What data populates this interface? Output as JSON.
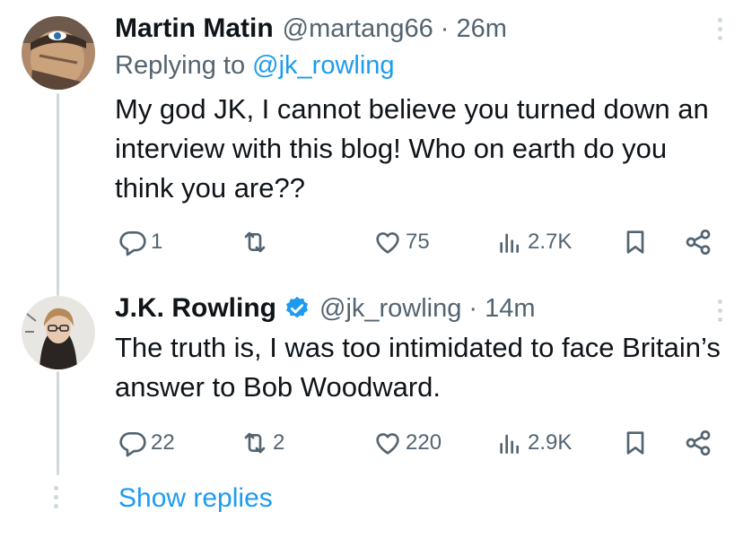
{
  "tweets": [
    {
      "name": "Martin Matin",
      "handle": "@martang66",
      "separator": "·",
      "time": "26m",
      "replying_prefix": "Replying to ",
      "replying_to": "@jk_rowling",
      "text": "My god JK, I cannot believe you turned down an interview with this blog! Who on earth do you think you are??",
      "verified": false,
      "stats": {
        "replies": "1",
        "retweets": "",
        "likes": "75",
        "views": "2.7K"
      },
      "avatar_icon": "user-avatar-icon"
    },
    {
      "name": "J.K. Rowling",
      "handle": "@jk_rowling",
      "separator": "·",
      "time": "14m",
      "text": "The truth is, I was too intimidated to face Britain’s answer to Bob Woodward.",
      "verified": true,
      "stats": {
        "replies": "22",
        "retweets": "2",
        "likes": "220",
        "views": "2.9K"
      },
      "avatar_icon": "user-avatar-icon"
    }
  ],
  "show_replies_label": "Show replies",
  "colors": {
    "text_primary": "#0f1419",
    "text_secondary": "#536471",
    "accent": "#1d9bf0",
    "thread_line": "#cfd9de"
  },
  "icons": [
    "reply-icon",
    "retweet-icon",
    "like-icon",
    "views-icon",
    "bookmark-icon",
    "share-icon",
    "more-icon",
    "verified-badge-icon"
  ]
}
